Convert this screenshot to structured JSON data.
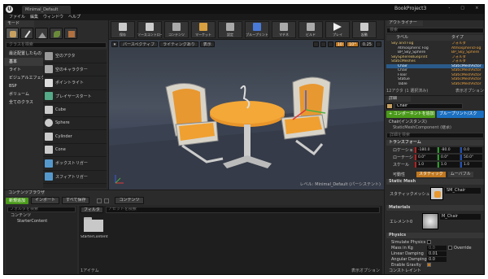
{
  "window": {
    "tab": "Minimal_Default",
    "project": "BookProject3",
    "controls": [
      "-",
      "□",
      "×"
    ]
  },
  "menu": [
    "ファイル",
    "編集",
    "ウィンドウ",
    "ヘルプ"
  ],
  "modes": {
    "tab": "モード",
    "search_placeholder": "クラスを検索",
    "categories": [
      "最近配置したもの",
      "基本",
      "ライト",
      "ビジュアルエフェクト",
      "BSP",
      "ボリューム",
      "全てのクラス"
    ],
    "selected_category": "基本",
    "items": [
      "空のアクタ",
      "空のキャラクター",
      "ポイントライト",
      "プレイヤースタート",
      "Cube",
      "Sphere",
      "Cylinder",
      "Cone",
      "ボックストリガー",
      "スフィアトリガー"
    ]
  },
  "toolbar": {
    "buttons": [
      "保存",
      "ソースコントロール",
      "コンテンツ",
      "マーケット",
      "設定",
      "ブループリント",
      "マチネ",
      "ビルド",
      "プレイ",
      "起動"
    ]
  },
  "viewport": {
    "perspective": "パースペクティブ",
    "lit": "ライティングあり",
    "show": "表示",
    "grid_value": "10",
    "angle_value": "10°",
    "scale_value": "0.25",
    "level_label": "レベル:",
    "level_name": "Minimal_Default (パーシステント)"
  },
  "outliner": {
    "tab": "アウトライナー",
    "search_placeholder": "検索",
    "col_label": "ラベル",
    "col_type": "タイプ",
    "rows": [
      {
        "label": "Sky and Fog",
        "type": "フォルダ"
      },
      {
        "label": "Atmospheric Fog",
        "type": "AtmosphericFog"
      },
      {
        "label": "BP_Sky_Sphere",
        "type": "BP_Sky_Sphere"
      },
      {
        "label": "SkySphereBlueprint",
        "type": "フォルダ"
      },
      {
        "label": "StaticMeshes",
        "type": "フォルダ"
      },
      {
        "label": "Chair",
        "type": "StaticMeshActor"
      },
      {
        "label": "Chair",
        "type": "StaticMeshActor"
      },
      {
        "label": "Floor",
        "type": "StaticMeshActor"
      },
      {
        "label": "Statue",
        "type": "StaticMeshActor"
      },
      {
        "label": "Table",
        "type": "StaticMeshActor"
      }
    ],
    "footer": "12アクタ (1 選択済み)",
    "view_options": "表示オプション"
  },
  "details": {
    "tab": "詳細",
    "actor_name": "Chair",
    "add_component": "+ コンポーネントを追加",
    "blueprint_script": "ブループリント/スク",
    "instance": "Chair(インスタンス)",
    "component": "StaticMeshComponent (継承)",
    "search_placeholder": "詳細を検索",
    "transform_header": "トランスフォーム",
    "location_label": "ロケーション",
    "rotation_label": "ローテーション",
    "scale_label": "スケール",
    "location": [
      "-180.0",
      "-80.0",
      "0.0"
    ],
    "rotation": [
      "0.0°",
      "0.0°",
      "50.0°"
    ],
    "scale": [
      "1.0",
      "1.0",
      "1.0"
    ],
    "mobility_label": "可動性",
    "mobility": [
      "スタティック",
      "ムーバブル"
    ],
    "static_mesh_header": "Static Mesh",
    "static_mesh_label": "スタティックメッシュ",
    "static_mesh_value": "SM_Chair",
    "materials_header": "Materials",
    "element_label": "エレメント0",
    "material_value": "M_Chair",
    "physics_header": "Physics",
    "physics_rows": [
      "Simulate Physics",
      "Mass in Kg",
      "Linear Damping",
      "Angular Damping",
      "Enable Gravity"
    ],
    "mass_value": "0.0",
    "linear_value": "0.01",
    "angular_value": "0.0",
    "override_label": "Override",
    "constraints": "コンストレイント"
  },
  "content_browser": {
    "tab": "コンテンツブラウザ",
    "new_button": "新規追加",
    "import_button": "インポート",
    "save_all_button": "すべて保存",
    "path": "コンテンツ",
    "search_folders_placeholder": "フォルダを検索",
    "filter_button": "フィルタ",
    "search_assets_placeholder": "アセットを検索",
    "tree": [
      "コンテンツ",
      "StarterContent"
    ],
    "asset_name": "StarterContent",
    "item_count": "1アイテム",
    "view_options": "表示オプション"
  },
  "colors": {
    "accent_orange": "#f0a030",
    "add_green": "#4a9a1a",
    "blueprint_blue": "#1b6fc0",
    "selection_blue": "#2a5a8a"
  }
}
